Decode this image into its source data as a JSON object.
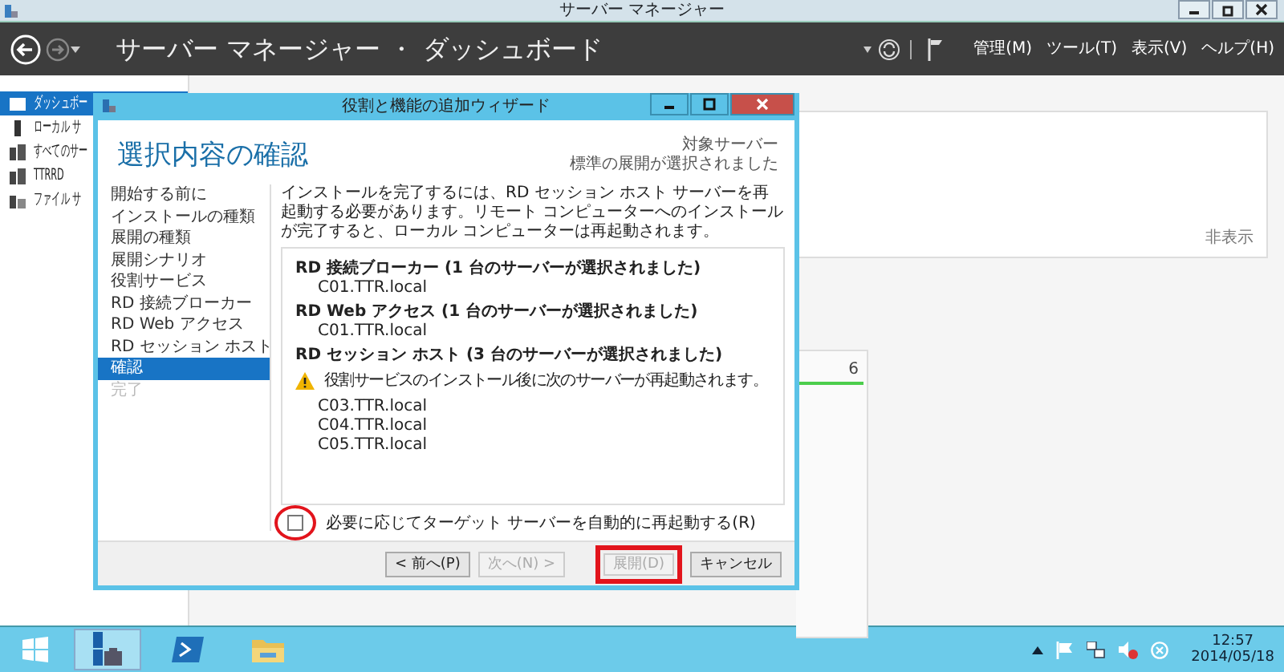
{
  "window": {
    "title": "サーバー マネージャー"
  },
  "header": {
    "breadcrumb": "サーバー マネージャー ・ ダッシュボード",
    "menus": [
      "管理(M)",
      "ツール(T)",
      "表示(V)",
      "ヘルプ(H)"
    ]
  },
  "sidebar": {
    "items": [
      {
        "label": "ダッシュボー",
        "kind": "dashboard",
        "selected": true
      },
      {
        "label": "ローカル サ",
        "kind": "server",
        "selected": false
      },
      {
        "label": "すべてのサー",
        "kind": "servers",
        "selected": false
      },
      {
        "label": "TTRRD",
        "kind": "servers",
        "selected": false
      },
      {
        "label": "ファイル サ",
        "kind": "files",
        "selected": false
      }
    ]
  },
  "dashboard": {
    "hide_link": "非表示",
    "tile_count": "6"
  },
  "wizard": {
    "title": "役割と機能の追加ウィザード",
    "heading": "選択内容の確認",
    "target": [
      "対象サーバー",
      "標準の展開が選択されました"
    ],
    "steps": [
      {
        "label": "開始する前に",
        "selected": false,
        "disabled": false
      },
      {
        "label": "インストールの種類",
        "selected": false,
        "disabled": false
      },
      {
        "label": "展開の種類",
        "selected": false,
        "disabled": false
      },
      {
        "label": "展開シナリオ",
        "selected": false,
        "disabled": false
      },
      {
        "label": "役割サービス",
        "selected": false,
        "disabled": false
      },
      {
        "label": "RD 接続ブローカー",
        "selected": false,
        "disabled": false
      },
      {
        "label": "RD Web アクセス",
        "selected": false,
        "disabled": false
      },
      {
        "label": "RD セッション ホスト",
        "selected": false,
        "disabled": false
      },
      {
        "label": "確認",
        "selected": true,
        "disabled": false
      },
      {
        "label": "完了",
        "selected": false,
        "disabled": true
      }
    ],
    "intro": "インストールを完了するには、RD セッション ホスト サーバーを再起動する必要があります。リモート コンピューターへのインストールが完了すると、ローカル コンピューターは再起動されます。",
    "sections": [
      {
        "heading": "RD 接続ブローカー (1 台のサーバーが選択されました)",
        "servers": [
          "C01.TTR.local"
        ]
      },
      {
        "heading": "RD Web アクセス (1 台のサーバーが選択されました)",
        "servers": [
          "C01.TTR.local"
        ]
      },
      {
        "heading": "RD セッション ホスト (3 台のサーバーが選択されました)",
        "warning": "役割サービスのインストール後に次のサーバーが再起動されます。",
        "servers": [
          "C03.TTR.local",
          "C04.TTR.local",
          "C05.TTR.local"
        ]
      }
    ],
    "restart_option": {
      "label": "必要に応じてターゲット サーバーを自動的に再起動する(R)",
      "checked": false,
      "circled": true
    },
    "buttons": [
      {
        "label": "< 前へ(P)",
        "disabled": false,
        "highlighted": false
      },
      {
        "label": "次へ(N) >",
        "disabled": true,
        "highlighted": false
      },
      {
        "label": "展開(D)",
        "disabled": true,
        "highlighted": true
      },
      {
        "label": "キャンセル",
        "disabled": false,
        "highlighted": false
      }
    ]
  },
  "taskbar": {
    "time": "12:57",
    "date": "2014/05/18"
  }
}
